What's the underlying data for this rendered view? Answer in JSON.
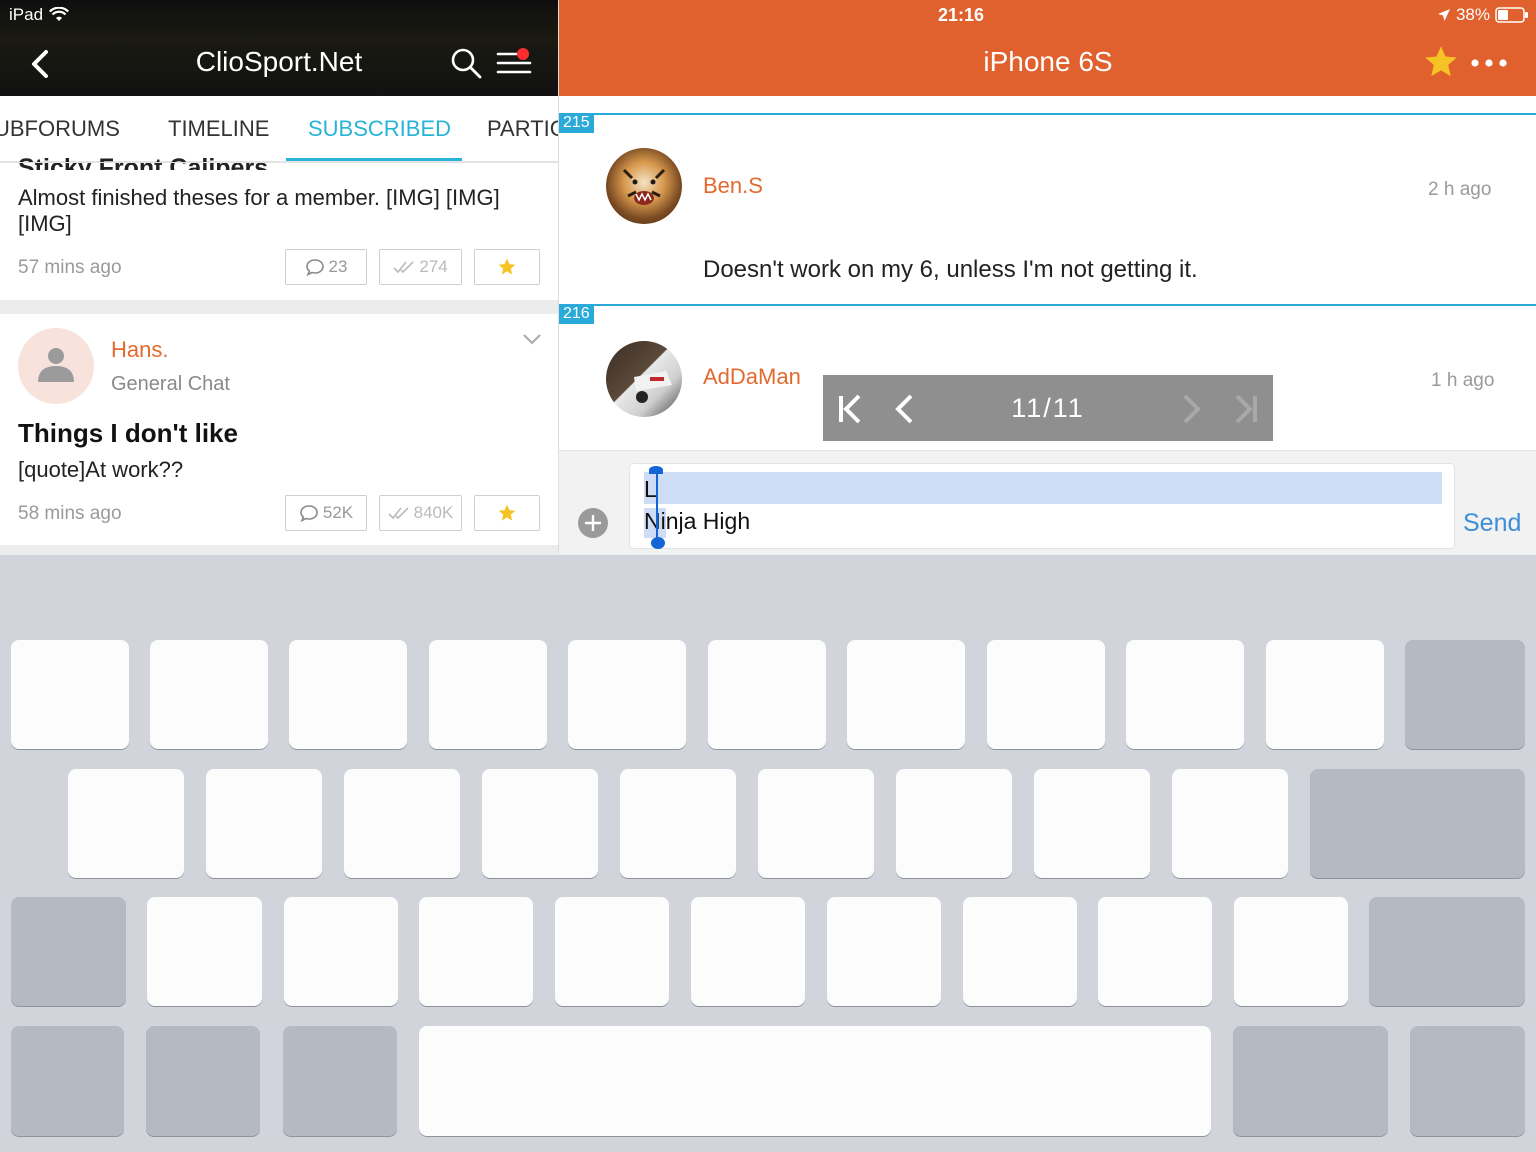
{
  "left": {
    "status_carrier": "iPad",
    "app_title": "ClioSport.Net",
    "tabs": [
      "UBFORUMS",
      "TIMELINE",
      "SUBSCRIBED",
      "PARTIC"
    ],
    "active_tab": "SUBSCRIBED",
    "post1": {
      "title_partial": "Sticky Front Calipers",
      "body": "Almost finished theses for a member.  [IMG]  [IMG]",
      "body2": "[IMG]",
      "time": "57 mins ago",
      "replies": "23",
      "views": "274"
    },
    "post2": {
      "author": "Hans.",
      "forum": "General Chat",
      "title": "Things I don't like",
      "body": "[quote]At work??",
      "time": "58 mins ago",
      "replies": "52K",
      "views": "840K"
    }
  },
  "right": {
    "clock": "21:16",
    "battery": "38%",
    "thread_title": "iPhone 6S",
    "posts": [
      {
        "number": "215",
        "author": "Ben.S",
        "time": "2 h ago",
        "body": "Doesn't work on my 6, unless I'm not getting it."
      },
      {
        "number": "216",
        "author": "AdDaMan",
        "time": "1 h ago"
      }
    ],
    "pager": "11/11",
    "composer": {
      "line1": "L",
      "line2": "Ninja High",
      "send_label": "Send"
    }
  },
  "colors": {
    "accent_orange": "#e0612d",
    "accent_blue": "#27b4d6",
    "author_orange": "#e36a2e",
    "send_blue": "#3d8fd6"
  }
}
